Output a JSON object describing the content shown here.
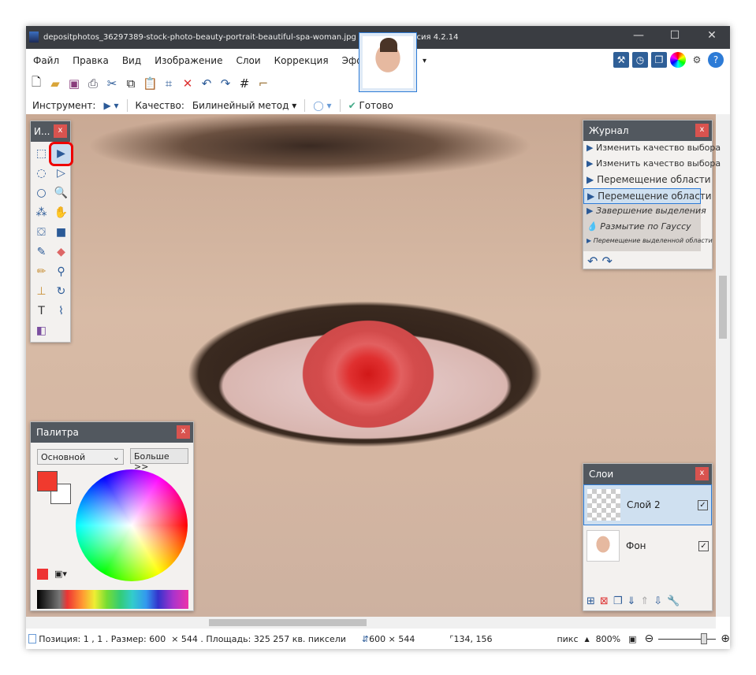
{
  "window": {
    "title": "depositphotos_36297389-stock-photo-beauty-portrait-beautiful-spa-woman.jpg - paint.net версия 4.2.14",
    "minimize": "—",
    "maximize": "☐",
    "close": "✕"
  },
  "menu": [
    "Файл",
    "Правка",
    "Вид",
    "Изображение",
    "Слои",
    "Коррекция",
    "Эффекты"
  ],
  "toolbar_icons": [
    "new-icon",
    "open-icon",
    "save-icon",
    "print-icon",
    "cut-icon",
    "copy-icon",
    "paste-icon",
    "crop-icon",
    "deselect-icon",
    "undo-icon",
    "redo-icon",
    "grid-icon",
    "ruler-icon"
  ],
  "right_icons": [
    "tools-icon",
    "history-icon",
    "layers-icon",
    "colors-icon",
    "gear-icon",
    "help-icon"
  ],
  "options": {
    "tool_label": "Инструмент:",
    "quality_label": "Качество:",
    "quality_value": "Билинейный метод",
    "done": "Готово"
  },
  "tools_panel": {
    "title": "И...",
    "close": "x"
  },
  "history": {
    "title": "Журнал",
    "close": "x",
    "items": [
      {
        "label": "Изменить качество выбора",
        "state": "done"
      },
      {
        "label": "Изменить качество выбора",
        "state": "done"
      },
      {
        "label": "Перемещение области",
        "state": "done"
      },
      {
        "label": "Перемещение области",
        "state": "current"
      },
      {
        "label": "Завершение выделения",
        "state": "undone"
      },
      {
        "label": "Размытие по Гауссу",
        "state": "undone"
      },
      {
        "label": "Перемещение выделенной области",
        "state": "undone"
      }
    ]
  },
  "palette": {
    "title": "Палитра",
    "close": "x",
    "mode": "Основной",
    "more": "Больше >>",
    "primary_color": "#f03a2e",
    "secondary_color": "#ffffff"
  },
  "layers": {
    "title": "Слои",
    "close": "x",
    "items": [
      {
        "name": "Слой 2",
        "visible": true,
        "selected": true
      },
      {
        "name": "Фон",
        "visible": true,
        "selected": false
      }
    ]
  },
  "status": {
    "position": "Позиция: 1 , 1 . Размер: 600  × 544 . Площадь: 325 257 кв. пиксели",
    "size": "600 × 544",
    "cursor": "134, 156",
    "units": "пикс",
    "zoom": "800%"
  }
}
